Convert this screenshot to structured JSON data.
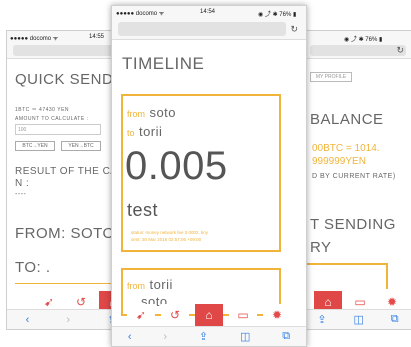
{
  "left": {
    "carrier": "●●●●● docomo ᯤ",
    "time": "14:55",
    "title": "QUICK SEND",
    "rate_line": "1BTC ＝ 47430 YEN",
    "amount_label": "AMOUNT TO CALCULATE :",
    "amount_value": "100",
    "btn_btc_yen": "BTC→YEN",
    "btn_yen_btc": "YEN→BTC",
    "result_line1": "RESULT OF THE CA",
    "result_line2": "N :",
    "result_dash": "----",
    "from_line": "FROM: SOTO",
    "to_line": "TO: ."
  },
  "middle": {
    "carrier": "●●●●● docomo ᯤ",
    "time": "14:54",
    "battery": "◉ ⤴ ✱ 76% ▮",
    "title": "TIMELINE",
    "card1": {
      "from_prefix": "from",
      "from_name": "soto",
      "to_prefix": "to",
      "to_name": "torii",
      "amount": "0.005",
      "message": "test",
      "status_line1": "status: money network fee 0.0002, tiny",
      "status_line2": "sent: 30 Mar 2016 02:57:06 +09:00"
    },
    "card2": {
      "from_prefix": "from",
      "from_name": "torii",
      "to_partial": "soto"
    }
  },
  "right": {
    "battery": "◉ ⤴ ✱ 76% ▮",
    "profile_btn": "MY PROFILE",
    "balance_title": "BALANCE",
    "balance_line1": "00BTC = 1014.",
    "balance_line2": "999999YEN",
    "balance_note": "D BY CURRENT RATE)",
    "history_line1": "T SENDING",
    "history_line2": "RY"
  },
  "icons": {
    "send": "paper-plane-icon",
    "history": "history-icon",
    "home": "home-icon",
    "card": "credit-card-icon",
    "settings": "gear-icon",
    "back": "chevron-left-icon",
    "forward": "chevron-right-icon",
    "share": "share-icon",
    "bookmarks": "book-icon",
    "tabs": "tabs-icon",
    "reload": "reload-icon"
  },
  "colors": {
    "accent_red": "#e04848",
    "accent_orange": "#f0b43b",
    "ios_blue": "#2f7de1"
  }
}
